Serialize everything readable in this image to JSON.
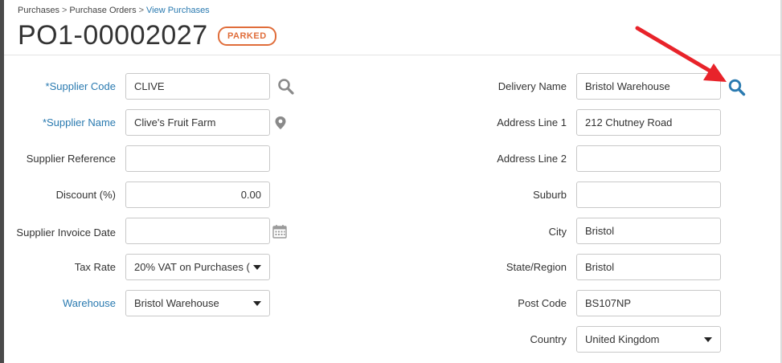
{
  "breadcrumb": {
    "items": [
      "Purchases",
      "Purchase Orders",
      "View Purchases"
    ],
    "separator": ">"
  },
  "header": {
    "title": "PO1-00002027",
    "status_badge": "PARKED"
  },
  "colors": {
    "accent": "#2a7ab0",
    "badge": "#e06d3a",
    "arrow": "#e8232a"
  },
  "supplier": {
    "code_label": "*Supplier Code",
    "code_value": "CLIVE",
    "name_label": "*Supplier Name",
    "name_value": "Clive's Fruit Farm",
    "reference_label": "Supplier Reference",
    "reference_value": "",
    "discount_label": "Discount (%)",
    "discount_value": "0.00",
    "invoice_date_label": "Supplier Invoice Date",
    "invoice_date_value": "",
    "tax_rate_label": "Tax Rate",
    "tax_rate_value": "20% VAT on Purchases (",
    "warehouse_label": "Warehouse",
    "warehouse_value": "Bristol Warehouse"
  },
  "delivery": {
    "name_label": "Delivery Name",
    "name_value": "Bristol Warehouse",
    "address1_label": "Address Line 1",
    "address1_value": "212 Chutney Road",
    "address2_label": "Address Line 2",
    "address2_value": "",
    "suburb_label": "Suburb",
    "suburb_value": "",
    "city_label": "City",
    "city_value": "Bristol",
    "region_label": "State/Region",
    "region_value": "Bristol",
    "postcode_label": "Post Code",
    "postcode_value": "BS107NP",
    "country_label": "Country",
    "country_value": "United Kingdom"
  }
}
